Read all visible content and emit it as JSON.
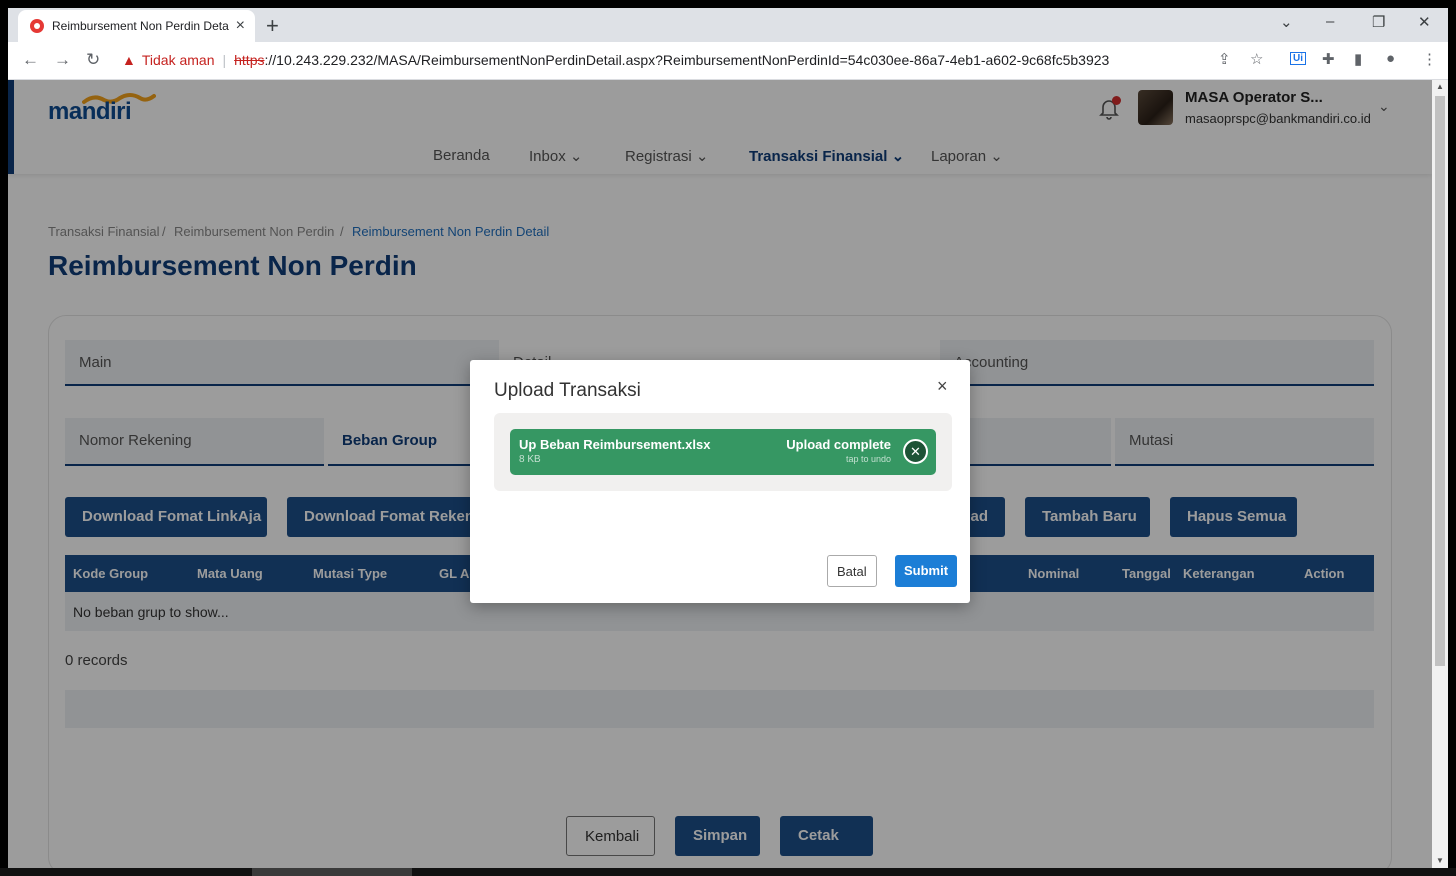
{
  "browser": {
    "tab_title": "Reimbursement Non Perdin Deta",
    "security_label": "Tidak aman",
    "url_scheme": "https",
    "url_rest": "://10.243.229.232/MASA/ReimbursementNonPerdinDetail.aspx?ReimbursementNonPerdinId=54c030ee-86a7-4eb1-a602-9c68fc5b3923"
  },
  "header": {
    "logo_text": "mandiri",
    "user_name": "MASA Operator S...",
    "user_email": "masaoprspc@bankmandiri.co.id",
    "nav": [
      "Beranda",
      "Inbox",
      "Registrasi",
      "Transaksi Finansial",
      "Laporan"
    ]
  },
  "breadcrumb": [
    "Transaksi Finansial",
    "Reimbursement Non Perdin",
    "Reimbursement Non Perdin Detail"
  ],
  "page_title": "Reimbursement Non Perdin",
  "main_tabs": [
    "Main",
    "Detail",
    "Accounting"
  ],
  "sub_tabs": [
    "Nomor Rekening",
    "Beban Group",
    "Mutasi"
  ],
  "actions": {
    "download_linkaja": "Download Fomat LinkAja",
    "download_rekening": "Download Fomat Rekening",
    "upload": "Upload",
    "tambah": "Tambah Baru",
    "hapus": "Hapus Semua"
  },
  "table": {
    "headers": [
      "Kode Group",
      "Mata Uang",
      "Mutasi Type",
      "GL Account",
      "Nominal",
      "Tanggal",
      "Keterangan",
      "Action"
    ],
    "empty": "No beban grup to show...",
    "records": "0 records"
  },
  "footer_buttons": {
    "back": "Kembali",
    "save": "Simpan",
    "print": "Cetak"
  },
  "modal": {
    "title": "Upload Transaksi",
    "file_name": "Up Beban Reimbursement.xlsx",
    "file_size": "8 KB",
    "status": "Upload complete",
    "undo_hint": "tap to undo",
    "cancel": "Batal",
    "submit": "Submit"
  },
  "colors": {
    "primary": "#1c4f8a",
    "accent": "#1c7ed6",
    "success": "#369763",
    "title": "#0f3d7a"
  }
}
